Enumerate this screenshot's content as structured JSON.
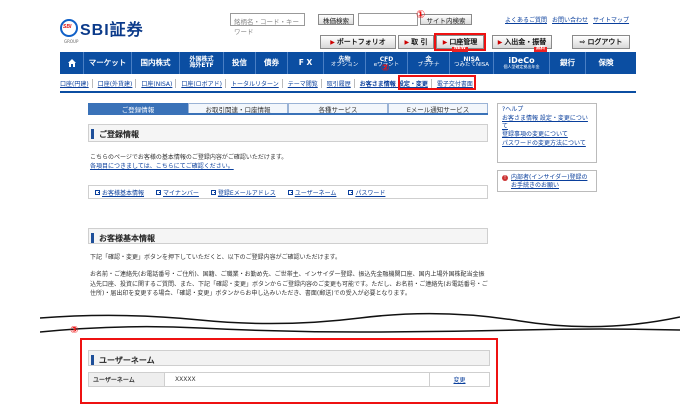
{
  "brand": {
    "logo_mark": "SBI",
    "name": "SBI証券",
    "sub": "GROUP"
  },
  "search": {
    "stock_placeholder": "銘柄名・コード・キーワード",
    "stock_button": "株価検索",
    "site_button": "サイト内検索"
  },
  "top_links": [
    "よくあるご質問",
    "お問い合わせ",
    "サイトマップ"
  ],
  "header_buttons": {
    "portfolio": "ポートフォリオ",
    "trade": "取 引",
    "account": "口座管理",
    "deposit": "入出金・振替",
    "logout": "ログアウト"
  },
  "callouts": {
    "one": "①",
    "two": "②",
    "three": "③"
  },
  "nav": [
    {
      "label": "マーケット"
    },
    {
      "label": "国内株式"
    },
    {
      "label": "外国株式",
      "sub": "海外ETF"
    },
    {
      "label": "投信"
    },
    {
      "label": "債券"
    },
    {
      "label": "F X"
    },
    {
      "label": "先物",
      "sub": "オプション"
    },
    {
      "label": "CFD",
      "sub": "eワラント"
    },
    {
      "label": "金",
      "sub": "プラチナ"
    },
    {
      "label": "NISA",
      "sub": "つみたてNISA",
      "badge": "NEW"
    },
    {
      "label": "iDeCo",
      "sub": "個人型確定拠出年金",
      "badge": "無料"
    },
    {
      "label": "銀行"
    },
    {
      "label": "保険"
    }
  ],
  "subnav": [
    "口座(円建)",
    "口座(外貨建)",
    "口座(NISA)",
    "口座(ロボアド)",
    "トータルリターン",
    "テーマ閲覧",
    "取引履歴",
    "お客さま情報 設定・変更",
    "電子交付書面"
  ],
  "tabs": [
    "ご登録情報",
    "お取引関連・口座情報",
    "各種サービス",
    "Eメール通知サービス"
  ],
  "section1": {
    "title": "ご登録情報",
    "intro": "こちらのページでお客様の基本情報のご登録内容がご確認いただけます。",
    "intro_link": "各項目につきましては、こちらにてご確認ください。"
  },
  "anchors": [
    "お客様基本情報",
    "マイナンバー",
    "登録Eメールアドレス",
    "ユーザーネーム",
    "パスワード"
  ],
  "section2": {
    "title": "お客様基本情報",
    "desc1": "下記「確認・変更」ボタンを押下していただくと、以下のご登録内容がご確認いただけます。",
    "desc2": "お名前・ご連絡先(お電話番号・ご住所)、国籍、ご職業・お勤め先、ご世帯主、インサイダー登録、振込先金融機関口座、国内上場外国株配当金振込先口座、投資に関するご質問、また、下記「確認・変更」ボタンからご登録内容のご変更も可能です。ただし、お名前・ご連絡先(お電話番号・ご住所)・届出印を変更する場合、「確認・変更」ボタンからお申し込みいただき、書面(郵送)での受入が必要となります。"
  },
  "section3": {
    "title": "ユーザーネーム",
    "label": "ユーザーネーム",
    "value": "XXXXX",
    "edit": "変更"
  },
  "help": {
    "title": "ヘルプ",
    "links": [
      "お客さま情報 設定・変更について",
      "登録事項の変更について",
      "パスワードの変更方法について"
    ]
  },
  "insider": {
    "text": "内部者(インサイダー)登録のお手続きのお願い"
  }
}
